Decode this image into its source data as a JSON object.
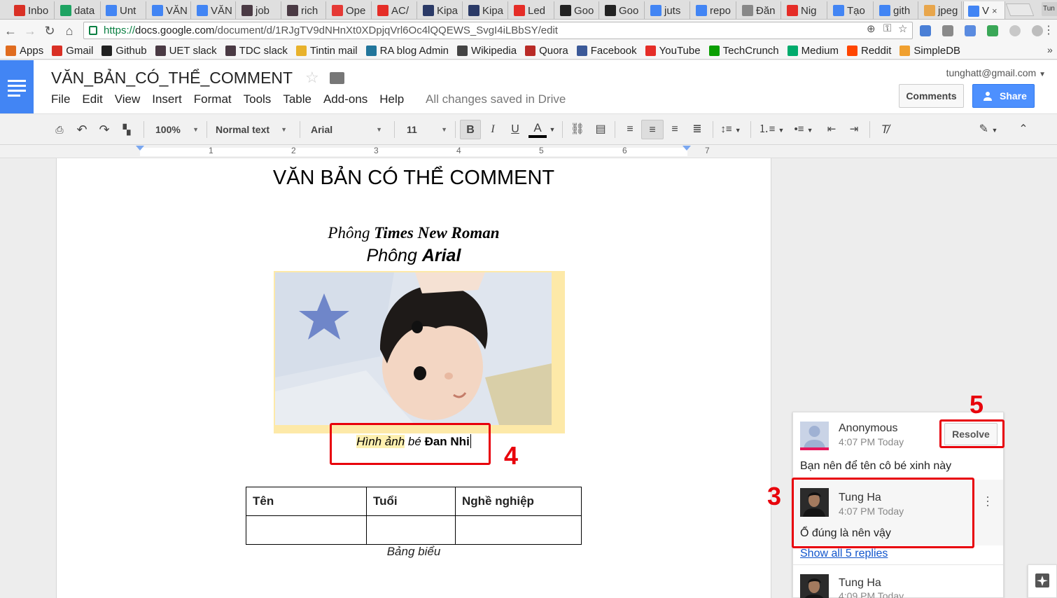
{
  "browser": {
    "tabs": [
      {
        "label": "Inbo",
        "icon": "gmail-icon",
        "color": "#d93025"
      },
      {
        "label": "data",
        "icon": "drive-icon",
        "color": "#1ea362"
      },
      {
        "label": "Unt",
        "icon": "docs-icon",
        "color": "#4285f4"
      },
      {
        "label": "VĂN",
        "icon": "docs-icon",
        "color": "#4285f4"
      },
      {
        "label": "VĂN",
        "icon": "docs-icon",
        "color": "#4285f4"
      },
      {
        "label": "job",
        "icon": "slack-hash-icon",
        "color": "#4a3a44"
      },
      {
        "label": "rich",
        "icon": "slack-hash-icon",
        "color": "#4a3a44"
      },
      {
        "label": "Ope",
        "icon": "pokeball-icon",
        "color": "#e53935"
      },
      {
        "label": "AC/",
        "icon": "youtube-icon",
        "color": "#e52d27"
      },
      {
        "label": "Kipa",
        "icon": "kipalog-icon",
        "color": "#2b3a67"
      },
      {
        "label": "Kipa",
        "icon": "kipalog-icon",
        "color": "#2b3a67"
      },
      {
        "label": "Led",
        "icon": "youtube-icon",
        "color": "#e52d27"
      },
      {
        "label": "Goo",
        "icon": "github-icon",
        "color": "#222222"
      },
      {
        "label": "Goo",
        "icon": "github-icon",
        "color": "#222222"
      },
      {
        "label": "juts",
        "icon": "google-icon",
        "color": "#4285f4"
      },
      {
        "label": "repo",
        "icon": "google-icon",
        "color": "#4285f4"
      },
      {
        "label": "Đăn",
        "icon": "page-icon",
        "color": "#888888"
      },
      {
        "label": "Nig",
        "icon": "youtube-icon",
        "color": "#e52d27"
      },
      {
        "label": "Tạo",
        "icon": "google-icon",
        "color": "#4285f4"
      },
      {
        "label": "gith",
        "icon": "google-icon",
        "color": "#4285f4"
      },
      {
        "label": "jpeg",
        "icon": "image-icon",
        "color": "#e8a64c"
      },
      {
        "label": "V",
        "icon": "docs-icon",
        "color": "#4285f4",
        "active": true
      }
    ],
    "profile": "Tun",
    "url": {
      "scheme": "https://",
      "host": "docs.google.com",
      "path": "/document/d/1RJgTV9dNHnXt0XDpjqVrl6Oc4lQQEWS_SvgI4iLBbSY/edit"
    },
    "bookmarks": [
      {
        "label": "Apps",
        "icon": "apps-grid-icon",
        "color": "#e06c1f"
      },
      {
        "label": "Gmail",
        "icon": "gmail-icon",
        "color": "#d93025"
      },
      {
        "label": "Github",
        "icon": "github-icon",
        "color": "#222222"
      },
      {
        "label": "UET slack",
        "icon": "slack-hash-icon",
        "color": "#4a3a44"
      },
      {
        "label": "TDC slack",
        "icon": "slack-hash-icon",
        "color": "#4a3a44"
      },
      {
        "label": "Tintin mail",
        "icon": "mail-icon",
        "color": "#e8b22b"
      },
      {
        "label": "RA blog Admin",
        "icon": "wordpress-icon",
        "color": "#21759b"
      },
      {
        "label": "Wikipedia",
        "icon": "wikipedia-icon",
        "color": "#444444"
      },
      {
        "label": "Quora",
        "icon": "quora-icon",
        "color": "#b92b27"
      },
      {
        "label": "Facebook",
        "icon": "facebook-icon",
        "color": "#3b5998"
      },
      {
        "label": "YouTube",
        "icon": "youtube-icon",
        "color": "#e52d27"
      },
      {
        "label": "TechCrunch",
        "icon": "techcrunch-icon",
        "color": "#0a9e01"
      },
      {
        "label": "Medium",
        "icon": "medium-icon",
        "color": "#00ab6c"
      },
      {
        "label": "Reddit",
        "icon": "reddit-icon",
        "color": "#ff4500"
      },
      {
        "label": "SimpleDB",
        "icon": "simpledb-icon",
        "color": "#f0a030"
      }
    ]
  },
  "docs": {
    "title": "VĂN_BẢN_CÓ_THỂ_COMMENT",
    "menu": [
      "File",
      "Edit",
      "View",
      "Insert",
      "Format",
      "Tools",
      "Table",
      "Add-ons",
      "Help"
    ],
    "save_status": "All changes saved in Drive",
    "account": "tunghatt@gmail.com",
    "comments_label": "Comments",
    "share_label": "Share",
    "accent_color": "#4285f4",
    "toolbar": {
      "zoom": "100%",
      "style": "Normal text",
      "font": "Arial",
      "size": "11",
      "bold": "B",
      "italic": "I",
      "underline": "U",
      "text_color": "A"
    },
    "ruler_numbers": [
      "1",
      "2",
      "3",
      "4",
      "5",
      "6",
      "7"
    ]
  },
  "document": {
    "heading": "VĂN BẢN CÓ THỂ COMMENT",
    "tnr_line": {
      "prefix": "Phông ",
      "strong": "Times New Roman"
    },
    "arial_line": {
      "prefix": "Phông ",
      "strong": "Arial"
    },
    "image_caption": {
      "highlight": "Hình ảnh",
      "middle": " bé ",
      "strong": "Đan Nhi"
    },
    "table": {
      "headers": [
        "Tên",
        "Tuổi",
        "Nghề nghiệp"
      ],
      "rows": [
        [
          "",
          "",
          ""
        ]
      ]
    },
    "table_caption": "Bảng biểu"
  },
  "comments": {
    "thread": {
      "author": "Anonymous",
      "time": "4:07 PM Today",
      "text": "Bạn nên để tên cô bé xinh này",
      "resolve_label": "Resolve"
    },
    "replies": [
      {
        "author": "Tung Ha",
        "time": "4:07 PM Today",
        "text": "Ổ đúng là nên vậy"
      },
      {
        "author": "Tung Ha",
        "time": "4:09 PM Today",
        "text": ""
      }
    ],
    "show_replies_label": "Show all 5 replies"
  },
  "annotations": {
    "labels": [
      "3",
      "4",
      "5"
    ],
    "color": "#e8000b"
  }
}
